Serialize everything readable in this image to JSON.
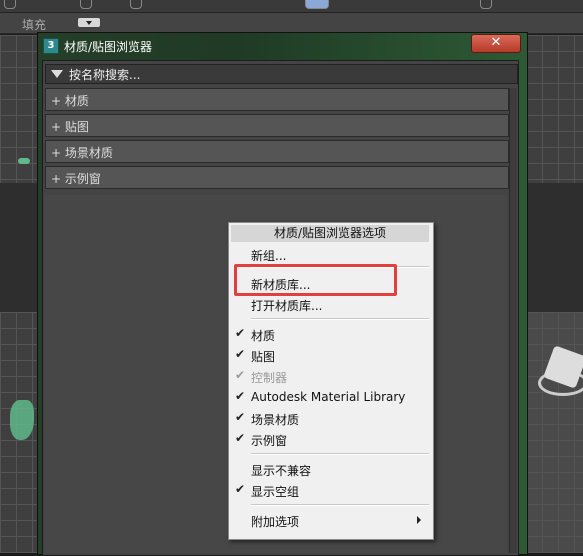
{
  "app": {
    "fill_label": "填充"
  },
  "dialog": {
    "icon_text": "3",
    "title": "材质/贴图浏览器",
    "close_symbol": "✕",
    "search_label": "按名称搜索...",
    "sections": [
      {
        "label": "+ 材质"
      },
      {
        "label": "+ 贴图"
      },
      {
        "label": "+ 场景材质"
      },
      {
        "label": "+ 示例窗"
      }
    ]
  },
  "menu": {
    "header": "材质/贴图浏览器选项",
    "items": [
      {
        "label": "新组...",
        "checked": false,
        "disabled": false
      },
      {
        "label": "新材质库...",
        "checked": false,
        "disabled": false
      },
      {
        "label": "打开材质库...",
        "checked": false,
        "disabled": false
      },
      {
        "label": "材质",
        "checked": true,
        "disabled": false
      },
      {
        "label": "贴图",
        "checked": true,
        "disabled": false
      },
      {
        "label": "控制器",
        "checked": true,
        "disabled": true
      },
      {
        "label": "Autodesk Material Library",
        "checked": true,
        "disabled": false
      },
      {
        "label": "场景材质",
        "checked": true,
        "disabled": false
      },
      {
        "label": "示例窗",
        "checked": true,
        "disabled": false
      },
      {
        "label": "显示不兼容",
        "checked": false,
        "disabled": false
      },
      {
        "label": "显示空组",
        "checked": true,
        "disabled": false
      },
      {
        "label": "附加选项",
        "checked": false,
        "disabled": false,
        "submenu": true
      }
    ],
    "check_glyph": "✔",
    "highlighted_item": "新材质库...",
    "highlight_color": "#e04040"
  }
}
